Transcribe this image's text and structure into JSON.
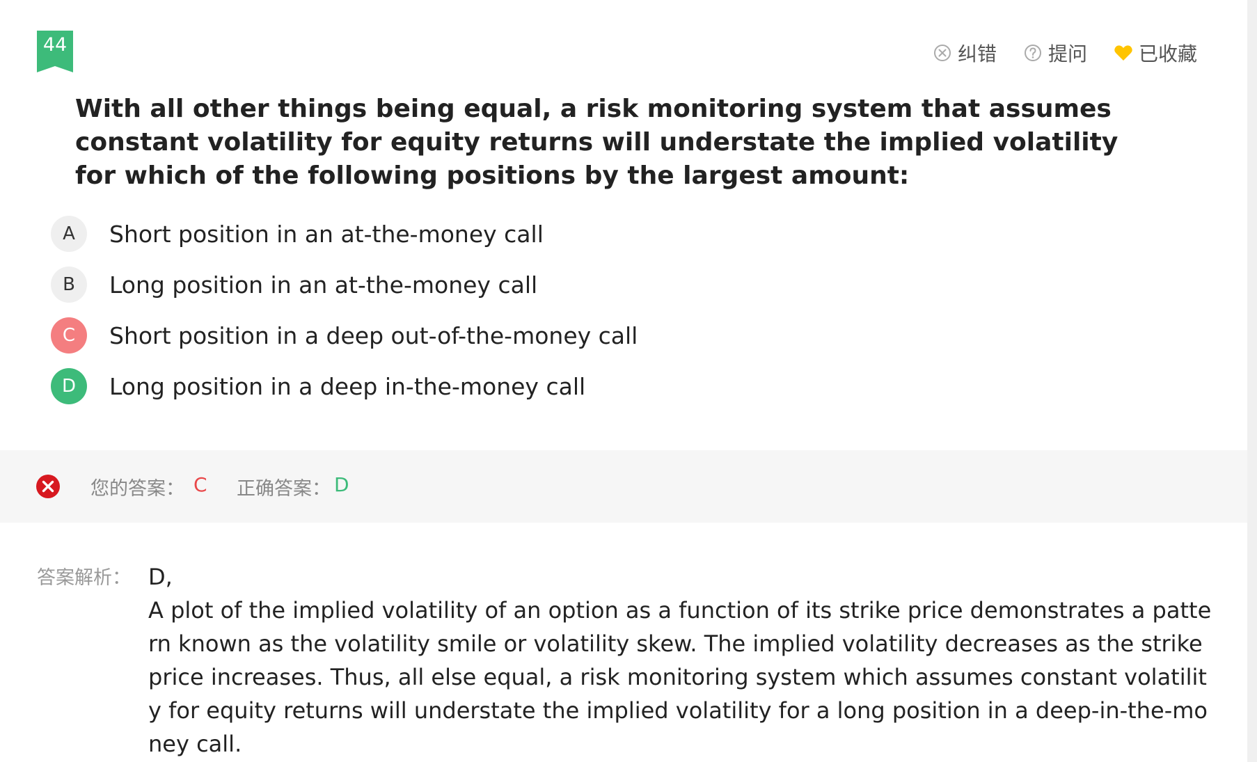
{
  "question_number": "44",
  "actions": {
    "report_error": "纠错",
    "ask": "提问",
    "favorited": "已收藏"
  },
  "question_text": "With all other things being equal, a risk monitoring system that assumes constant volatility for equity returns will understate the implied volatility for which of the following positions by the largest amount:",
  "options": [
    {
      "letter": "A",
      "text": "Short position in an at-the-money call"
    },
    {
      "letter": "B",
      "text": "Long position in an at-the-money call"
    },
    {
      "letter": "C",
      "text": "Short position in a deep out-of-the-money call"
    },
    {
      "letter": "D",
      "text": "Long position in a deep in-the-money call"
    }
  ],
  "result": {
    "your_answer_label": "您的答案：",
    "your_answer": "C",
    "correct_answer_label": "正确答案：",
    "correct_answer": "D"
  },
  "analysis": {
    "label": "答案解析：",
    "first_line": "D,",
    "body": "A plot of the implied volatility of an option as a function of its strike price demonstrates a pattern known as the volatility smile or volatility skew. The implied volatility decreases as the strike price increases. Thus, all else equal, a risk monitoring system which assumes constant volatility for equity returns will understate the implied volatility for a long position in a deep-in-the-money call."
  },
  "colors": {
    "accent_green": "#3dbb7a",
    "wrong_red": "#f47e80",
    "error_icon_red": "#d71920",
    "favorite_yellow": "#ffc400"
  },
  "icons": {
    "report_error": "circle-x-icon",
    "ask": "circle-question-icon",
    "favorite": "heart-icon",
    "result": "error-x-icon"
  }
}
